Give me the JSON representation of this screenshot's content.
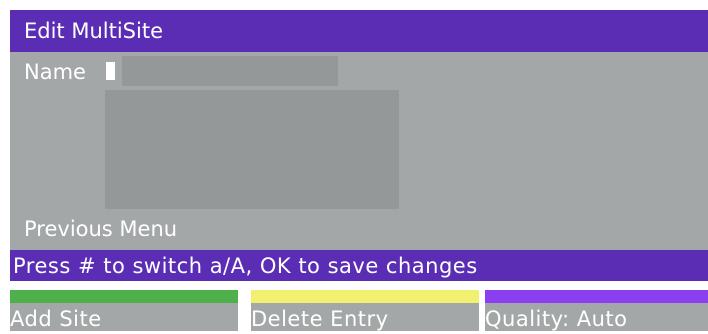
{
  "title_bar": {
    "title": "Edit MultiSite"
  },
  "form": {
    "name_label": "Name",
    "name_value": "",
    "previous_menu_label": "Previous Menu"
  },
  "status_bar": {
    "hint": "Press # to switch a/A, OK to save changes"
  },
  "softkeys": [
    {
      "label": "Add Site",
      "color": "#4db04a"
    },
    {
      "label": "Delete Entry",
      "color": "#f2f071"
    },
    {
      "label": "Quality: Auto",
      "color": "#8b3ef0"
    }
  ],
  "colors": {
    "accent": "#5a2db4",
    "panel": "#a4a7a7",
    "field": "#959898"
  }
}
